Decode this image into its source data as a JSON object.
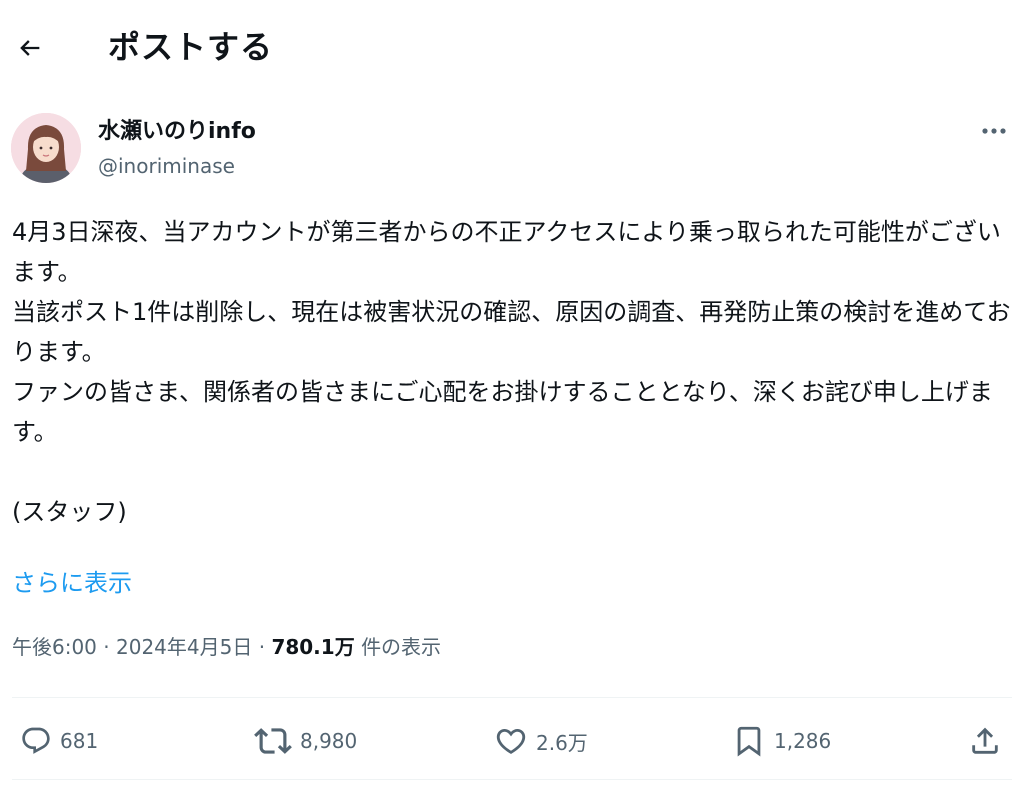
{
  "header": {
    "back_icon": "arrow-left-icon",
    "title": "ポストする"
  },
  "author": {
    "display_name": "水瀬いのりinfo",
    "handle": "@inoriminase",
    "more_icon": "ellipsis-icon"
  },
  "tweet": {
    "text": "4月3日深夜、当アカウントが第三者からの不正アクセスにより乗っ取られた可能性がございます。\n当該ポスト1件は削除し、現在は被害状況の確認、原因の調査、再発防止策の検討を進めております。\nファンの皆さま、関係者の皆さまにご心配をお掛けすることとなり、深くお詫び申し上げます。\n\n(スタッフ)",
    "show_more": "さらに表示",
    "time": "午後6:00",
    "separator": "·",
    "date": "2024年4月5日",
    "views_count": "780.1万",
    "views_label": "件の表示"
  },
  "actions": {
    "reply": {
      "icon": "reply-icon",
      "count": "681"
    },
    "retweet": {
      "icon": "retweet-icon",
      "count": "8,980"
    },
    "like": {
      "icon": "heart-icon",
      "count": "2.6万"
    },
    "bookmark": {
      "icon": "bookmark-icon",
      "count": "1,286"
    },
    "share": {
      "icon": "share-icon"
    }
  },
  "colors": {
    "text": "#0f1419",
    "secondary": "#536471",
    "link": "#1d9bf0",
    "divider": "#eff3f4"
  }
}
